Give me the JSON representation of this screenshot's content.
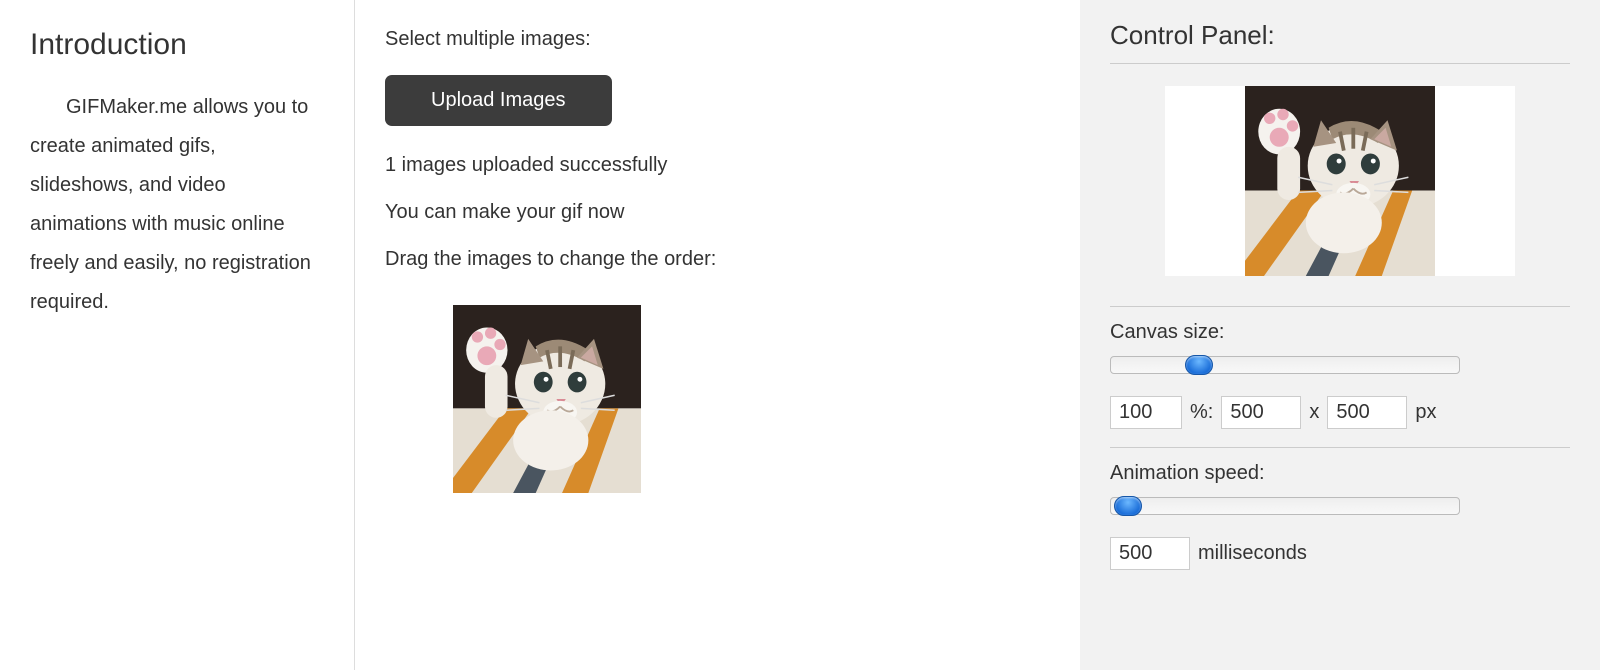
{
  "intro": {
    "title": "Introduction",
    "body": "GIFMaker.me allows you to create animated gifs, slideshows, and video animations with music online freely and easily, no registration required."
  },
  "main": {
    "select_label": "Select multiple images:",
    "upload_button": "Upload Images",
    "upload_status": "1 images uploaded successfully",
    "make_now": "You can make your gif now",
    "drag_hint": "Drag the images to change the order:"
  },
  "control_panel": {
    "title": "Control Panel:",
    "canvas_size_label": "Canvas size:",
    "canvas_percent": "100",
    "percent_label": "%:",
    "canvas_width": "500",
    "x_label": "x",
    "canvas_height": "500",
    "px_label": "px",
    "canvas_slider_percent": 23,
    "animation_speed_label": "Animation speed:",
    "animation_ms": "500",
    "ms_label": "milliseconds",
    "speed_slider_percent": 1
  }
}
